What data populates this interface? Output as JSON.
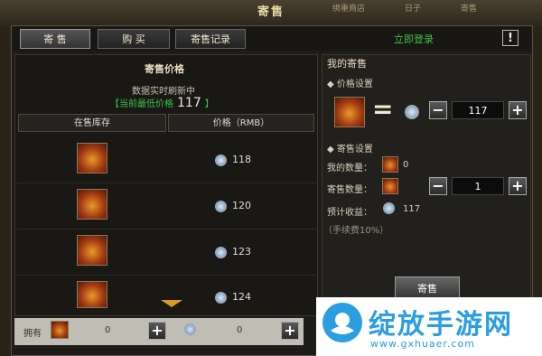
{
  "window": {
    "title": "寄售",
    "top_nav": [
      "绑重商店",
      "日子",
      "寄售"
    ]
  },
  "tabs": [
    {
      "label": "寄 售"
    },
    {
      "label": "购 买"
    },
    {
      "label": "寄售记录"
    }
  ],
  "header_right": {
    "login": "立即登录",
    "alert": "!"
  },
  "market": {
    "title": "寄售价格",
    "refresh_note": "数据实时刷新中",
    "lowest_label": "【当前最低价格",
    "lowest_value": "117",
    "lowest_suffix": "】",
    "col_stock": "在售库存",
    "col_price": "价格（RMB）",
    "rows": [
      {
        "price": "118"
      },
      {
        "price": "120"
      },
      {
        "price": "123"
      },
      {
        "price": "124"
      }
    ]
  },
  "bottom": {
    "own_label": "拥有",
    "own_count": "0",
    "value": "0"
  },
  "my_sell": {
    "title": "我的寄售",
    "price_section": "价格设置",
    "equals": "=",
    "price_value": "117",
    "sell_section": "寄售设置",
    "my_qty_label": "我的数量：",
    "my_qty": "0",
    "sell_qty_label": "寄售数量：",
    "sell_qty": "1",
    "income_label": "预计收益：",
    "income": "117",
    "fee_note": "（手续费10%）",
    "sell_button": "寄售"
  },
  "watermark": {
    "text": "绽放手游网",
    "url": "www.gxhuaer.com"
  }
}
